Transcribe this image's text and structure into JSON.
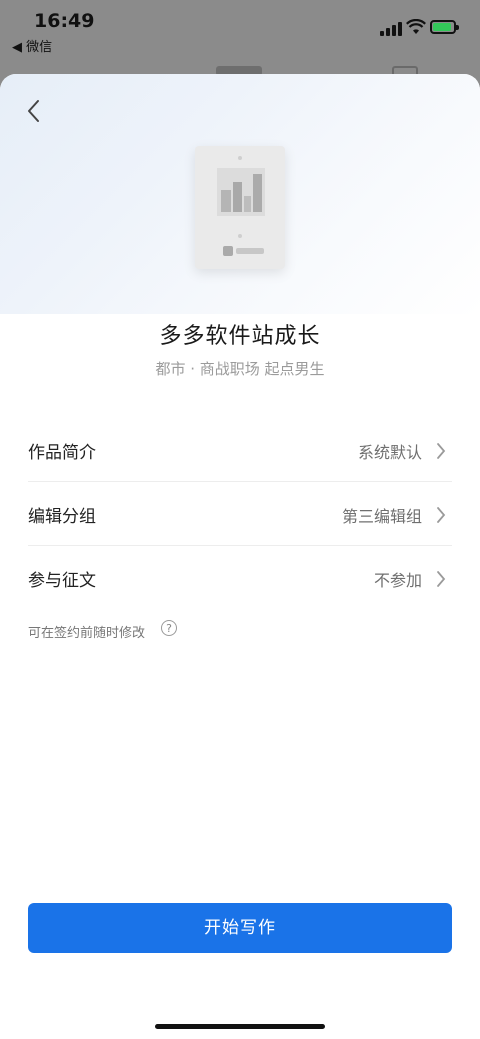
{
  "status_bar": {
    "time": "16:49",
    "back_app": "◀ 微信"
  },
  "sheet": {
    "book_title": "多多软件站成长",
    "book_meta": "都市 · 商战职场  起点男生",
    "rows": [
      {
        "label": "作品简介",
        "value": "系统默认"
      },
      {
        "label": "编辑分组",
        "value": "第三编辑组"
      },
      {
        "label": "参与征文",
        "value": "不参加"
      }
    ],
    "hint": "可在签约前随时修改",
    "help_glyph": "?",
    "cta_label": "开始写作"
  },
  "colors": {
    "accent": "#1a73e8",
    "battery": "#33c759"
  }
}
